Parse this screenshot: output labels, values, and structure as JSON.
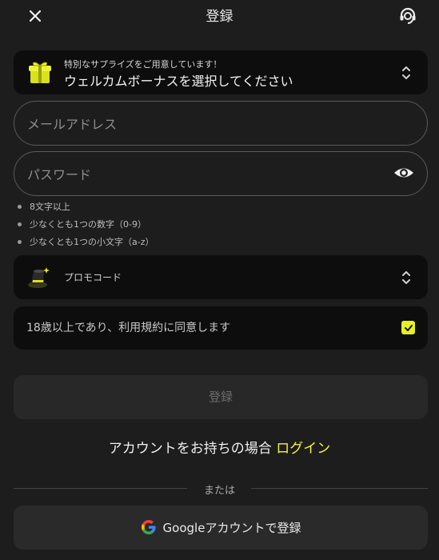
{
  "header": {
    "title": "登録",
    "close_icon": "close-icon",
    "support_icon": "headset-icon"
  },
  "bonus": {
    "subtitle": "特別なサプライズをご用意しています！",
    "label": "ウェルカムボーナスを選択してください",
    "icon": "gift-icon"
  },
  "form": {
    "email_placeholder": "メールアドレス",
    "password_placeholder": "パスワード",
    "password_rules": [
      "8文字以上",
      "少なくとも1つの数字（0-9）",
      "少なくとも1つの小文字（a-z）"
    ]
  },
  "promo": {
    "label": "プロモコード",
    "icon": "magic-hat-icon"
  },
  "agree": {
    "label": "18歳以上であり、利用規約に同意します",
    "checked": true
  },
  "register_button": "登録",
  "login": {
    "prompt": "アカウントをお持ちの場合",
    "link": "ログイン"
  },
  "divider_text": "または",
  "google": {
    "label": "Googleアカウントで登録"
  },
  "colors": {
    "accent": "#f1f63a",
    "checkbox": "#e6f01e",
    "background": "#1d1d1d",
    "panel": "#0d0d0d"
  }
}
